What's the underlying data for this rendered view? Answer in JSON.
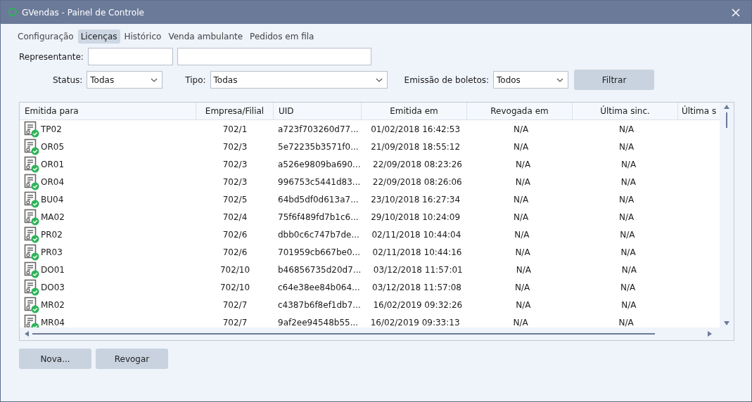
{
  "window": {
    "title": "GVendas - Painel de Controle"
  },
  "tabs": [
    {
      "label": "Configuração",
      "selected": false
    },
    {
      "label": "Licenças",
      "selected": true
    },
    {
      "label": "Histórico",
      "selected": false
    },
    {
      "label": "Venda ambulante",
      "selected": false
    },
    {
      "label": "Pedidos em fila",
      "selected": false
    }
  ],
  "filters": {
    "representante_label": "Representante:",
    "status_label": "Status:",
    "status_value": "Todas",
    "tipo_label": "Tipo:",
    "tipo_value": "Todas",
    "boletos_label": "Emissão de boletos:",
    "boletos_value": "Todos",
    "filter_button": "Filtrar"
  },
  "table": {
    "columns": [
      "Emitida para",
      "Empresa/Filial",
      "UID",
      "Emitida em",
      "Revogada em",
      "Última sinc.",
      "Última s"
    ],
    "rows": [
      [
        "TP02",
        "702/1",
        "a723f703260d77...",
        "01/02/2018 16:42:53",
        "N/A",
        "N/A"
      ],
      [
        "OR05",
        "702/3",
        "5e72235b3571f0...",
        "21/09/2018 18:55:12",
        "N/A",
        "N/A"
      ],
      [
        "OR01",
        "702/3",
        "a526e9809ba690...",
        "22/09/2018 08:23:26",
        "N/A",
        "N/A"
      ],
      [
        "OR04",
        "702/3",
        "996753c5441d83...",
        "22/09/2018 08:26:06",
        "N/A",
        "N/A"
      ],
      [
        "BU04",
        "702/5",
        "64bd5df0d613a7...",
        "23/10/2018 16:27:34",
        "N/A",
        "N/A"
      ],
      [
        "MA02",
        "702/4",
        "75f6f489fd7b1c6...",
        "29/10/2018 10:24:09",
        "N/A",
        "N/A"
      ],
      [
        "PR02",
        "702/6",
        "dbb0c6c747b7de...",
        "02/11/2018 10:44:04",
        "N/A",
        "N/A"
      ],
      [
        "PR03",
        "702/6",
        "701959cb667be0...",
        "02/11/2018 10:44:16",
        "N/A",
        "N/A"
      ],
      [
        "DO01",
        "702/10",
        "b46856735d20d7...",
        "03/12/2018 11:57:01",
        "N/A",
        "N/A"
      ],
      [
        "DO03",
        "702/10",
        "c64e38ee84b064...",
        "03/12/2018 11:57:08",
        "N/A",
        "N/A"
      ],
      [
        "MR02",
        "702/7",
        "c4387b6f8ef1db7...",
        "16/02/2019 09:32:26",
        "N/A",
        "N/A"
      ],
      [
        "MR04",
        "702/7",
        "9af2ee94548b55...",
        "16/02/2019 09:33:13",
        "N/A",
        "N/A"
      ]
    ]
  },
  "buttons": [
    "Nova...",
    "Revogar"
  ]
}
